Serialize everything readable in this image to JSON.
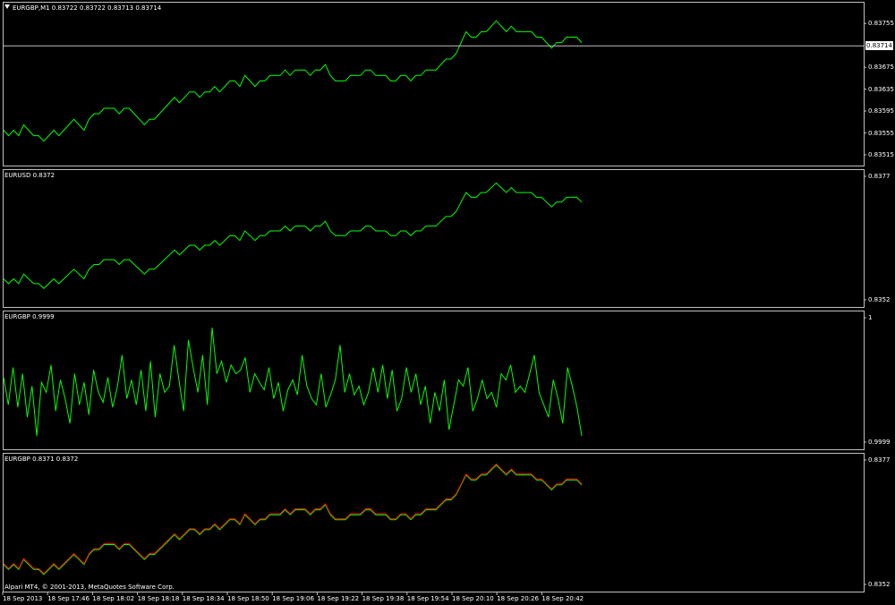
{
  "colors": {
    "background": "#000000",
    "grid": "#c0c0c0",
    "series_green": "#00ff00",
    "series_red": "#ff0000",
    "text": "#ffffff"
  },
  "icons": {
    "pane_menu": "triangle-down-icon"
  },
  "chart_data": [
    {
      "type": "line",
      "label": "EURGBP,M1  0.83722 0.83722 0.83713 0.83714",
      "ylim": [
        0.83515,
        0.83775
      ],
      "yticks": [
        "0.83755",
        "0.83675",
        "0.83635",
        "0.83595",
        "0.83555",
        "0.83515"
      ],
      "current_price": "0.83714",
      "series": [
        {
          "color": "#00ff00",
          "values": [
            0.8356,
            0.8355,
            0.8356,
            0.8355,
            0.8357,
            0.8356,
            0.8355,
            0.8355,
            0.8354,
            0.8355,
            0.8356,
            0.8355,
            0.8356,
            0.8357,
            0.8358,
            0.8357,
            0.8356,
            0.8358,
            0.8359,
            0.8359,
            0.836,
            0.836,
            0.836,
            0.8359,
            0.836,
            0.836,
            0.8359,
            0.8358,
            0.8357,
            0.8358,
            0.8358,
            0.8359,
            0.836,
            0.8361,
            0.8362,
            0.8361,
            0.8362,
            0.8363,
            0.8363,
            0.8362,
            0.8363,
            0.8363,
            0.8364,
            0.8363,
            0.8364,
            0.8365,
            0.8365,
            0.8364,
            0.8366,
            0.8365,
            0.8364,
            0.8365,
            0.8365,
            0.8366,
            0.8366,
            0.8366,
            0.8367,
            0.8366,
            0.8367,
            0.8367,
            0.8367,
            0.8366,
            0.8367,
            0.8367,
            0.8368,
            0.8366,
            0.8365,
            0.8365,
            0.8365,
            0.8366,
            0.8366,
            0.8366,
            0.8367,
            0.8367,
            0.8366,
            0.8366,
            0.8366,
            0.8365,
            0.8365,
            0.8366,
            0.8366,
            0.8365,
            0.8366,
            0.8366,
            0.8367,
            0.8367,
            0.8367,
            0.8368,
            0.8369,
            0.8369,
            0.837,
            0.8372,
            0.8374,
            0.8373,
            0.8373,
            0.8374,
            0.8374,
            0.8375,
            0.8376,
            0.8375,
            0.8374,
            0.8375,
            0.8374,
            0.8374,
            0.8374,
            0.8374,
            0.8373,
            0.8373,
            0.8372,
            0.8371,
            0.8372,
            0.8372,
            0.8373,
            0.8373,
            0.8373,
            0.8372
          ]
        }
      ]
    },
    {
      "type": "line",
      "label": "EURUSD 0.8372",
      "ylim": [
        0.8352,
        0.8377
      ],
      "yticks": [
        "0.8377",
        "0.8352"
      ],
      "series": [
        {
          "color": "#00ff00",
          "values": [
            0.8356,
            0.8355,
            0.8356,
            0.8355,
            0.8357,
            0.8356,
            0.8355,
            0.8355,
            0.8354,
            0.8355,
            0.8356,
            0.8355,
            0.8356,
            0.8357,
            0.8358,
            0.8357,
            0.8356,
            0.8358,
            0.8359,
            0.8359,
            0.836,
            0.836,
            0.836,
            0.8359,
            0.836,
            0.836,
            0.8359,
            0.8358,
            0.8357,
            0.8358,
            0.8358,
            0.8359,
            0.836,
            0.8361,
            0.8362,
            0.8361,
            0.8362,
            0.8363,
            0.8363,
            0.8362,
            0.8363,
            0.8363,
            0.8364,
            0.8363,
            0.8364,
            0.8365,
            0.8365,
            0.8364,
            0.8366,
            0.8365,
            0.8364,
            0.8365,
            0.8365,
            0.8366,
            0.8366,
            0.8366,
            0.8367,
            0.8366,
            0.8367,
            0.8367,
            0.8367,
            0.8366,
            0.8367,
            0.8367,
            0.8368,
            0.8366,
            0.8365,
            0.8365,
            0.8365,
            0.8366,
            0.8366,
            0.8366,
            0.8367,
            0.8367,
            0.8366,
            0.8366,
            0.8366,
            0.8365,
            0.8365,
            0.8366,
            0.8366,
            0.8365,
            0.8366,
            0.8366,
            0.8367,
            0.8367,
            0.8367,
            0.8368,
            0.8369,
            0.8369,
            0.837,
            0.8372,
            0.8374,
            0.8373,
            0.8373,
            0.8374,
            0.8374,
            0.8375,
            0.8376,
            0.8375,
            0.8374,
            0.8375,
            0.8374,
            0.8374,
            0.8374,
            0.8374,
            0.8373,
            0.8373,
            0.8372,
            0.8371,
            0.8372,
            0.8372,
            0.8373,
            0.8373,
            0.8373,
            0.8372
          ]
        }
      ]
    },
    {
      "type": "line",
      "label": "EURGBP 0.9999",
      "ylim": [
        0.9999,
        1
      ],
      "yticks": [
        "1",
        "0.9999"
      ],
      "series": [
        {
          "color": "#00ff00",
          "values": [
            0.52,
            0.3,
            0.6,
            0.28,
            0.55,
            0.2,
            0.45,
            0.05,
            0.48,
            0.4,
            0.62,
            0.25,
            0.5,
            0.35,
            0.15,
            0.55,
            0.3,
            0.48,
            0.22,
            0.58,
            0.4,
            0.32,
            0.52,
            0.28,
            0.44,
            0.7,
            0.35,
            0.5,
            0.3,
            0.58,
            0.25,
            0.65,
            0.2,
            0.55,
            0.4,
            0.45,
            0.78,
            0.5,
            0.25,
            0.82,
            0.6,
            0.4,
            0.7,
            0.3,
            0.92,
            0.55,
            0.65,
            0.48,
            0.62,
            0.55,
            0.58,
            0.68,
            0.4,
            0.55,
            0.48,
            0.42,
            0.6,
            0.35,
            0.48,
            0.25,
            0.42,
            0.5,
            0.38,
            0.7,
            0.45,
            0.35,
            0.3,
            0.55,
            0.28,
            0.38,
            0.5,
            0.78,
            0.4,
            0.55,
            0.38,
            0.45,
            0.3,
            0.4,
            0.6,
            0.4,
            0.62,
            0.35,
            0.58,
            0.25,
            0.35,
            0.6,
            0.4,
            0.55,
            0.3,
            0.45,
            0.15,
            0.4,
            0.25,
            0.5,
            0.1,
            0.3,
            0.5,
            0.45,
            0.6,
            0.25,
            0.35,
            0.5,
            0.35,
            0.4,
            0.28,
            0.55,
            0.5,
            0.62,
            0.4,
            0.45,
            0.4,
            0.55,
            0.7,
            0.4,
            0.3,
            0.2,
            0.5,
            0.35,
            0.15,
            0.6,
            0.45,
            0.28,
            0.05
          ]
        }
      ]
    },
    {
      "type": "line",
      "label": "EURGBP 0.8371 0.8372",
      "ylim": [
        0.8352,
        0.8377
      ],
      "yticks": [
        "0.8377",
        "0.8352"
      ],
      "series": [
        {
          "color": "#00ff00",
          "values": [
            0.8356,
            0.8355,
            0.8356,
            0.8355,
            0.8357,
            0.8356,
            0.8355,
            0.8355,
            0.8354,
            0.8355,
            0.8356,
            0.8355,
            0.8356,
            0.8357,
            0.8358,
            0.8357,
            0.8356,
            0.8358,
            0.8359,
            0.8359,
            0.836,
            0.836,
            0.836,
            0.8359,
            0.836,
            0.836,
            0.8359,
            0.8358,
            0.8357,
            0.8358,
            0.8358,
            0.8359,
            0.836,
            0.8361,
            0.8362,
            0.8361,
            0.8362,
            0.8363,
            0.8363,
            0.8362,
            0.8363,
            0.8363,
            0.8364,
            0.8363,
            0.8364,
            0.8365,
            0.8365,
            0.8364,
            0.8366,
            0.8365,
            0.8364,
            0.8365,
            0.8365,
            0.8366,
            0.8366,
            0.8366,
            0.8367,
            0.8366,
            0.8367,
            0.8367,
            0.8367,
            0.8366,
            0.8367,
            0.8367,
            0.8368,
            0.8366,
            0.8365,
            0.8365,
            0.8365,
            0.8366,
            0.8366,
            0.8366,
            0.8367,
            0.8367,
            0.8366,
            0.8366,
            0.8366,
            0.8365,
            0.8365,
            0.8366,
            0.8366,
            0.8365,
            0.8366,
            0.8366,
            0.8367,
            0.8367,
            0.8367,
            0.8368,
            0.8369,
            0.8369,
            0.837,
            0.8372,
            0.8374,
            0.8373,
            0.8373,
            0.8374,
            0.8374,
            0.8375,
            0.8376,
            0.8375,
            0.8374,
            0.8375,
            0.8374,
            0.8374,
            0.8374,
            0.8374,
            0.8373,
            0.8373,
            0.8372,
            0.8371,
            0.8372,
            0.8372,
            0.8373,
            0.8373,
            0.8373,
            0.8372
          ]
        },
        {
          "color": "#ff0000",
          "values": [
            0.83562,
            0.83552,
            0.83562,
            0.83552,
            0.83572,
            0.83562,
            0.83552,
            0.83552,
            0.83542,
            0.83552,
            0.83562,
            0.83552,
            0.83562,
            0.83572,
            0.83582,
            0.83572,
            0.83562,
            0.83582,
            0.83592,
            0.83592,
            0.83602,
            0.83602,
            0.83602,
            0.83592,
            0.83602,
            0.83602,
            0.83592,
            0.83582,
            0.83572,
            0.83582,
            0.83582,
            0.83592,
            0.83602,
            0.83612,
            0.83622,
            0.83612,
            0.83622,
            0.83632,
            0.83632,
            0.83622,
            0.83632,
            0.83632,
            0.83642,
            0.83632,
            0.83642,
            0.83652,
            0.83652,
            0.83642,
            0.83662,
            0.83652,
            0.83642,
            0.83652,
            0.83652,
            0.83662,
            0.83662,
            0.83662,
            0.83672,
            0.83662,
            0.83672,
            0.83672,
            0.83672,
            0.83662,
            0.83672,
            0.83672,
            0.83682,
            0.83662,
            0.83652,
            0.83652,
            0.83652,
            0.83662,
            0.83662,
            0.83662,
            0.83672,
            0.83672,
            0.83662,
            0.83662,
            0.83662,
            0.83652,
            0.83652,
            0.83662,
            0.83662,
            0.83652,
            0.83662,
            0.83662,
            0.83672,
            0.83672,
            0.83672,
            0.83682,
            0.83692,
            0.83692,
            0.83702,
            0.83722,
            0.83742,
            0.83732,
            0.83732,
            0.83742,
            0.83742,
            0.83752,
            0.83762,
            0.83752,
            0.83742,
            0.83752,
            0.83742,
            0.83742,
            0.83742,
            0.83742,
            0.83732,
            0.83732,
            0.83722,
            0.83712,
            0.83722,
            0.83722,
            0.83732,
            0.83732,
            0.83732,
            0.83722
          ]
        }
      ]
    }
  ],
  "x_axis_ticks": [
    "18 Sep 2013",
    "18 Sep 17:46",
    "18 Sep 18:02",
    "18 Sep 18:18",
    "18 Sep 18:34",
    "18 Sep 18:50",
    "18 Sep 19:06",
    "18 Sep 19:22",
    "18 Sep 19:38",
    "18 Sep 19:54",
    "18 Sep 20:10",
    "18 Sep 20:26",
    "18 Sep 20:42"
  ],
  "copyright": "Alpari MT4, © 2001-2013, MetaQuotes Software Corp."
}
